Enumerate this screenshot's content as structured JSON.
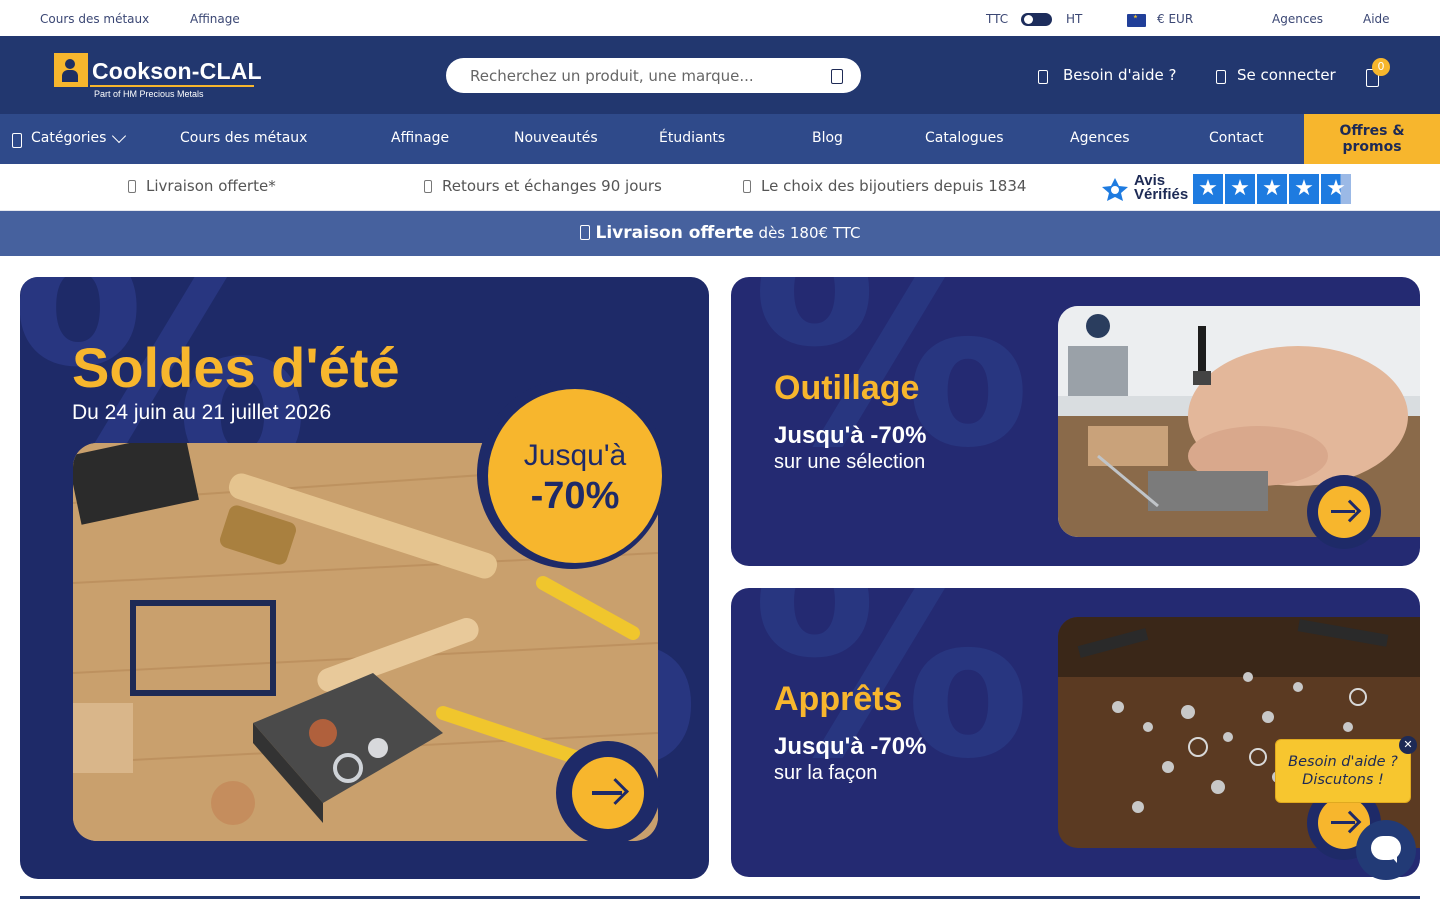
{
  "topbar": {
    "links_left": [
      "Cours des métaux",
      "Affinage"
    ],
    "tax_on": "TTC",
    "tax_off": "HT",
    "currency": "€ EUR",
    "links_right": [
      "Agences",
      "Aide"
    ]
  },
  "header": {
    "logo_name": "Cookson-CLAL",
    "logo_sub": "Part of HM Precious Metals",
    "search_placeholder": "Recherchez un produit, une marque...",
    "help_label": "Besoin d'aide ?",
    "login_label": "Se connecter",
    "cart_count": "0"
  },
  "nav": {
    "categories_label": "Catégories",
    "items": [
      "Cours des métaux",
      "Affinage",
      "Nouveautés",
      "Étudiants",
      "Blog",
      "Catalogues",
      "Agences",
      "Contact"
    ],
    "promo_line1": "Offres &",
    "promo_line2": "promos"
  },
  "reassurance": {
    "items": [
      "Livraison offerte*",
      "Retours et échanges 90 jours",
      "Le choix des bijoutiers depuis 1834"
    ],
    "avis_line1": "Avis",
    "avis_line2": "Vérifiés"
  },
  "banner": {
    "strong": "Livraison offerte",
    "rest": " dès 180€ TTC"
  },
  "hero": {
    "title": "Soldes d'été",
    "dates": "Du 24 juin au 21 juillet 2026",
    "badge_line1": "Jusqu'à",
    "badge_line2": "-70%"
  },
  "cards": [
    {
      "title": "Outillage",
      "line1": "Jusqu'à -70%",
      "line2": "sur une sélection"
    },
    {
      "title": "Apprêts",
      "line1": "Jusqu'à -70%",
      "line2": "sur la façon"
    }
  ],
  "chat": {
    "bubble_line1": "Besoin d'aide ?",
    "bubble_line2": "Discutons !",
    "close": "✕"
  },
  "colors": {
    "navy": "#22376f",
    "nav_blue": "#2f4a8a",
    "accent": "#f7b62d",
    "card_bg": "#1e2a68",
    "banner": "#46619e"
  }
}
